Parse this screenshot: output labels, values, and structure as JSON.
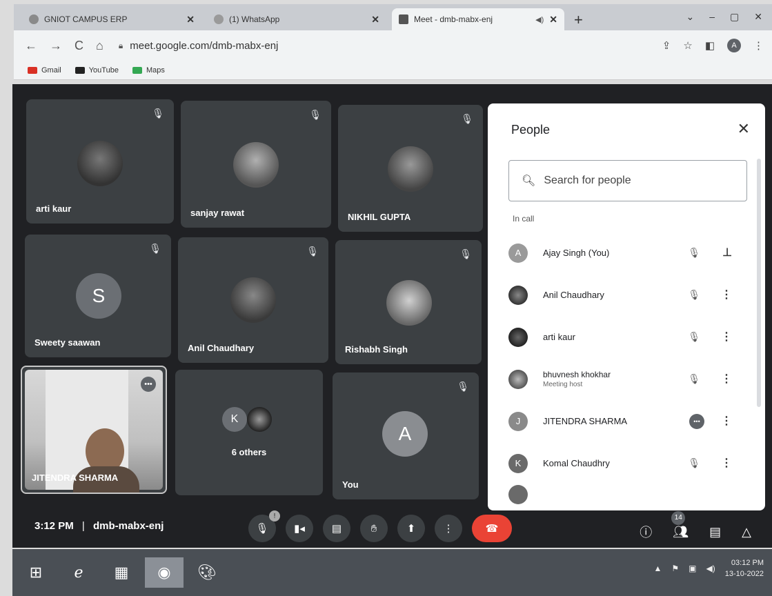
{
  "browser": {
    "tabs": [
      {
        "title": "GNIOT CAMPUS ERP",
        "favicon_color": "#8a8a8a"
      },
      {
        "title": "(1) WhatsApp",
        "favicon_color": "#9a9a9a"
      },
      {
        "title": "Meet - dmb-mabx-enj",
        "favicon_color": "#555555"
      }
    ],
    "close_glyph": "✕",
    "new_tab": "+",
    "url": "meet.google.com/dmb-mabx-enj",
    "profile_initial": "A",
    "bookmarks": [
      {
        "label": "Gmail",
        "color": "#d93025"
      },
      {
        "label": "YouTube",
        "color": "#222222"
      },
      {
        "label": "Maps",
        "color": "#34a853"
      }
    ]
  },
  "tiles": [
    {
      "name": "arti kaur",
      "kind": "photo",
      "muted": true
    },
    {
      "name": "sanjay rawat",
      "kind": "photo",
      "muted": true
    },
    {
      "name": "NIKHIL GUPTA",
      "kind": "photo",
      "muted": true
    },
    {
      "name": "Sweety saawan",
      "kind": "letter",
      "letter": "S",
      "color": "#6b6f74",
      "muted": true
    },
    {
      "name": "Anil Chaudhary",
      "kind": "photo",
      "muted": true
    },
    {
      "name": "Rishabh Singh",
      "kind": "photo",
      "muted": true
    },
    {
      "name": "JITENDRA SHARMA",
      "kind": "video",
      "muted": false
    },
    {
      "name": "6 others",
      "kind": "group",
      "letter": "K",
      "muted": false
    },
    {
      "name": "You",
      "kind": "letter",
      "letter": "A",
      "color": "#8a8d91",
      "muted": true
    }
  ],
  "people_panel": {
    "title": "People",
    "search_placeholder": "Search for people",
    "section_label": "In call",
    "participants": [
      {
        "name": "Ajay Singh (You)",
        "avatar": "A",
        "avatar_color": "#9a9a9a",
        "muted": true,
        "action_icon": "pin-icon"
      },
      {
        "name": "Anil Chaudhary",
        "avatar": "",
        "avatar_color": "#4a4a4a",
        "muted": true,
        "action_icon": "more-vert-icon"
      },
      {
        "name": "arti kaur",
        "avatar": "",
        "avatar_color": "#3a3a3a",
        "muted": true,
        "action_icon": "more-vert-icon"
      },
      {
        "name": "bhuvnesh khokhar",
        "subtitle": "Meeting host",
        "avatar": "",
        "avatar_color": "#6a6a6a",
        "muted": true,
        "action_icon": "more-vert-icon"
      },
      {
        "name": "JITENDRA SHARMA",
        "avatar": "J",
        "avatar_color": "#8a8a8a",
        "muted": false,
        "speaking": true,
        "action_icon": "more-vert-icon"
      },
      {
        "name": "Komal Chaudhry",
        "avatar": "K",
        "avatar_color": "#6a6a6a",
        "muted": true,
        "action_icon": "more-vert-icon"
      }
    ]
  },
  "bottom_bar": {
    "time": "3:12 PM",
    "meeting_code": "dmb-mabx-enj",
    "separator": "|",
    "mic_badge": "!",
    "people_count": "14"
  },
  "taskbar": {
    "clock_time": "03:12 PM",
    "clock_date": "13-10-2022"
  }
}
